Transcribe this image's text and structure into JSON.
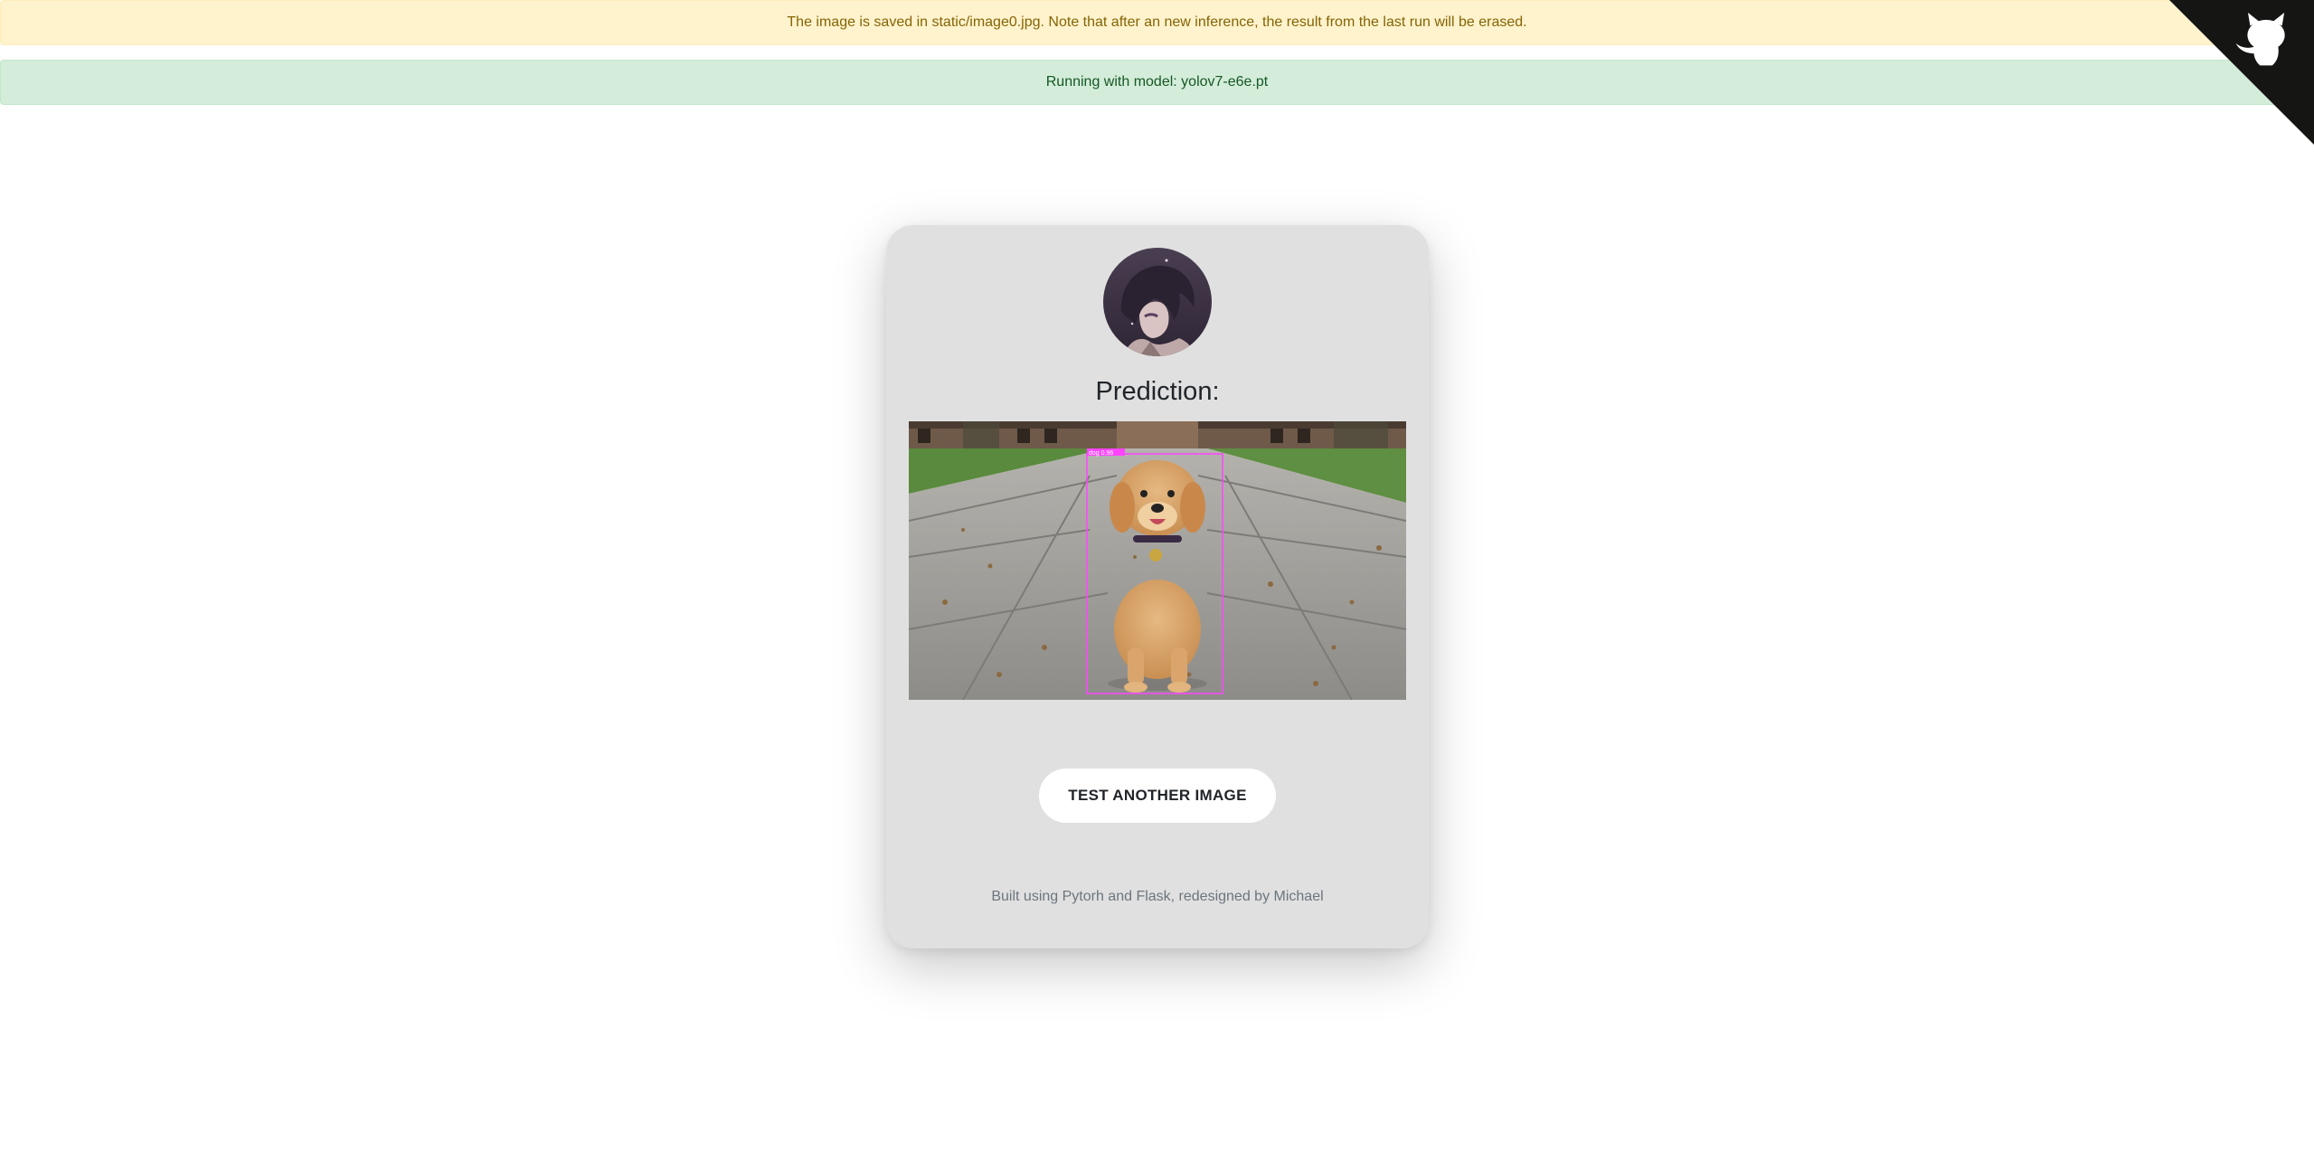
{
  "alerts": {
    "warning_text": "The image is saved in static/image0.jpg. Note that after an new inference, the result from the last run will be erased.",
    "success_text": "Running with model: yolov7-e6e.pt"
  },
  "corner": {
    "icon": "github-octocat-icon",
    "color": "#151513"
  },
  "card": {
    "avatar_icon": "anime-avatar",
    "title": "Prediction:",
    "detection_label": "dog 0.96",
    "button_label": "TEST ANOTHER IMAGE",
    "footer": "Built using Pytorh and Flask, redesigned by Michael"
  },
  "colors": {
    "warning_bg": "#fff3cd",
    "success_bg": "#d4edda",
    "card_bg": "#e0e0e0",
    "bbox": "#ff44ff"
  }
}
